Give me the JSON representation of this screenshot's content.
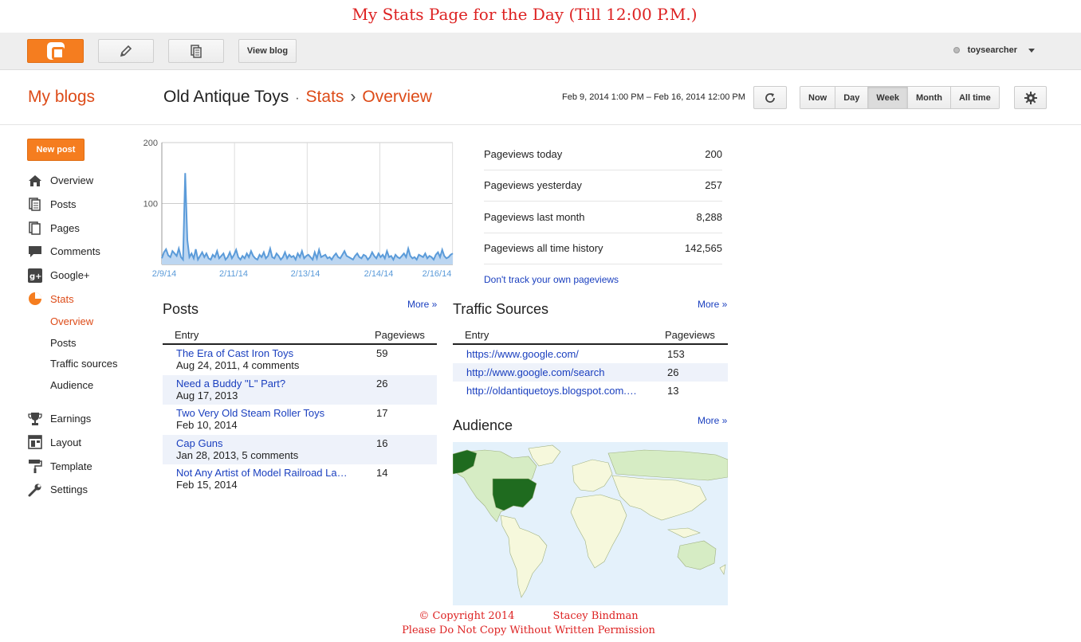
{
  "caption_top": "My Stats Page for the Day (Till 12:00 P.M.)",
  "topbar": {
    "view_blog": "View blog",
    "username": "toysearcher"
  },
  "header": {
    "my_blogs": "My blogs",
    "blog_name": "Old Antique Toys",
    "crumb_sep1": "·",
    "crumb_stats": "Stats",
    "crumb_sep2": "›",
    "crumb_overview": "Overview",
    "date_range": "Feb 9, 2014 1:00 PM – Feb 16, 2014 12:00 PM",
    "ranges": [
      "Now",
      "Day",
      "Week",
      "Month",
      "All time"
    ],
    "active_range": "Week"
  },
  "sidebar": {
    "new_post": "New post",
    "items": [
      {
        "label": "Overview",
        "icon": "home-icon"
      },
      {
        "label": "Posts",
        "icon": "posts-icon"
      },
      {
        "label": "Pages",
        "icon": "pages-icon"
      },
      {
        "label": "Comments",
        "icon": "comments-icon"
      },
      {
        "label": "Google+",
        "icon": "google-plus-icon"
      },
      {
        "label": "Stats",
        "icon": "stats-icon"
      }
    ],
    "stats_sub": [
      "Overview",
      "Posts",
      "Traffic sources",
      "Audience"
    ],
    "items2": [
      {
        "label": "Earnings",
        "icon": "trophy-icon"
      },
      {
        "label": "Layout",
        "icon": "layout-icon"
      },
      {
        "label": "Template",
        "icon": "template-icon"
      },
      {
        "label": "Settings",
        "icon": "wrench-icon"
      }
    ]
  },
  "chart_data": {
    "type": "area",
    "x_ticks": [
      "2/9/14",
      "2/11/14",
      "2/13/14",
      "2/14/14",
      "2/16/14"
    ],
    "y_ticks": [
      "200",
      "100"
    ],
    "ylim": [
      0,
      200
    ],
    "values": [
      10,
      20,
      25,
      15,
      12,
      22,
      18,
      14,
      26,
      12,
      8,
      150,
      40,
      12,
      18,
      10,
      25,
      8,
      14,
      20,
      12,
      18,
      10,
      8,
      16,
      12,
      22,
      10,
      14,
      18,
      8,
      12,
      20,
      10,
      16,
      24,
      12,
      8,
      14,
      10,
      18,
      12,
      22,
      14,
      10,
      8,
      16,
      12,
      20,
      10,
      14,
      26,
      12,
      10,
      18,
      14,
      8,
      12,
      20,
      10,
      16,
      12,
      14,
      8,
      18,
      12,
      22,
      10,
      14,
      16,
      12,
      8,
      20,
      10,
      24,
      12,
      14,
      16,
      10,
      12,
      8,
      14,
      18,
      12,
      10,
      16,
      22,
      14,
      12,
      10,
      8,
      14,
      18,
      12,
      10,
      16,
      14,
      8,
      12,
      20,
      14,
      10,
      18,
      12,
      16,
      10,
      22,
      12,
      14,
      8,
      16,
      12,
      10,
      14,
      18,
      12,
      26,
      14,
      10,
      12,
      8,
      16,
      14,
      12,
      18,
      10,
      14,
      12,
      8,
      16,
      20,
      12,
      24,
      14,
      10,
      12,
      16,
      18
    ],
    "color": "#5b9bd9"
  },
  "pageviews": [
    {
      "label": "Pageviews today",
      "value": "200"
    },
    {
      "label": "Pageviews yesterday",
      "value": "257"
    },
    {
      "label": "Pageviews last month",
      "value": "8,288"
    },
    {
      "label": "Pageviews all time history",
      "value": "142,565"
    }
  ],
  "dont_track": "Don't track your own pageviews",
  "posts": {
    "title": "Posts",
    "more": "More »",
    "col_entry": "Entry",
    "col_pageviews": "Pageviews",
    "rows": [
      {
        "title": "The Era of Cast Iron Toys",
        "meta": "Aug 24, 2011, 4 comments",
        "views": "59"
      },
      {
        "title": "Need a Buddy \"L\" Part?",
        "meta": "Aug 17, 2013",
        "views": "26"
      },
      {
        "title": "Two Very Old Steam Roller Toys",
        "meta": "Feb 10, 2014",
        "views": "17"
      },
      {
        "title": "Cap Guns",
        "meta": "Jan 28, 2013, 5 comments",
        "views": "16"
      },
      {
        "title": "Not Any Artist of Model Railroad La…",
        "meta": "Feb 15, 2014",
        "views": "14"
      }
    ]
  },
  "traffic": {
    "title": "Traffic Sources",
    "more": "More »",
    "col_entry": "Entry",
    "col_pageviews": "Pageviews",
    "rows": [
      {
        "url": "https://www.google.com/",
        "views": "153"
      },
      {
        "url": "http://www.google.com/search",
        "views": "26"
      },
      {
        "url": "http://oldantiquetoys.blogspot.com.…",
        "views": "13"
      }
    ]
  },
  "audience": {
    "title": "Audience",
    "more": "More »"
  },
  "copyright": {
    "line1a": "© Copyright 2014",
    "line1b": "Stacey Bindman",
    "line2": "Please Do Not Copy Without Written Permission"
  }
}
